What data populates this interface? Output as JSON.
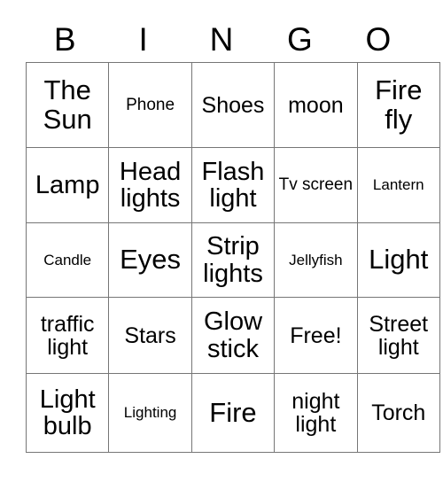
{
  "card": {
    "headers": [
      "B",
      "I",
      "N",
      "G",
      "O"
    ],
    "rows": [
      [
        {
          "text": "The Sun",
          "size": "xl"
        },
        {
          "text": "Phone",
          "size": "sm"
        },
        {
          "text": "Shoes",
          "size": "md"
        },
        {
          "text": "moon",
          "size": "md"
        },
        {
          "text": "Fire fly",
          "size": "xl"
        }
      ],
      [
        {
          "text": "Lamp",
          "size": "lg"
        },
        {
          "text": "Head lights",
          "size": "lg"
        },
        {
          "text": "Flash light",
          "size": "lg"
        },
        {
          "text": "Tv screen",
          "size": "sm"
        },
        {
          "text": "Lantern",
          "size": "xs"
        }
      ],
      [
        {
          "text": "Candle",
          "size": "xs"
        },
        {
          "text": "Eyes",
          "size": "xl"
        },
        {
          "text": "Strip lights",
          "size": "lg"
        },
        {
          "text": "Jellyfish",
          "size": "xs"
        },
        {
          "text": "Light",
          "size": "xl"
        }
      ],
      [
        {
          "text": "traffic light",
          "size": "md"
        },
        {
          "text": "Stars",
          "size": "md"
        },
        {
          "text": "Glow stick",
          "size": "lg"
        },
        {
          "text": "Free!",
          "size": "md"
        },
        {
          "text": "Street light",
          "size": "md"
        }
      ],
      [
        {
          "text": "Light bulb",
          "size": "lg"
        },
        {
          "text": "Lighting",
          "size": "xs"
        },
        {
          "text": "Fire",
          "size": "xl"
        },
        {
          "text": "night light",
          "size": "md"
        },
        {
          "text": "Torch",
          "size": "md"
        }
      ]
    ],
    "colors": {
      "text": "#000000",
      "grid_line": "#767676",
      "background": "#ffffff"
    }
  }
}
